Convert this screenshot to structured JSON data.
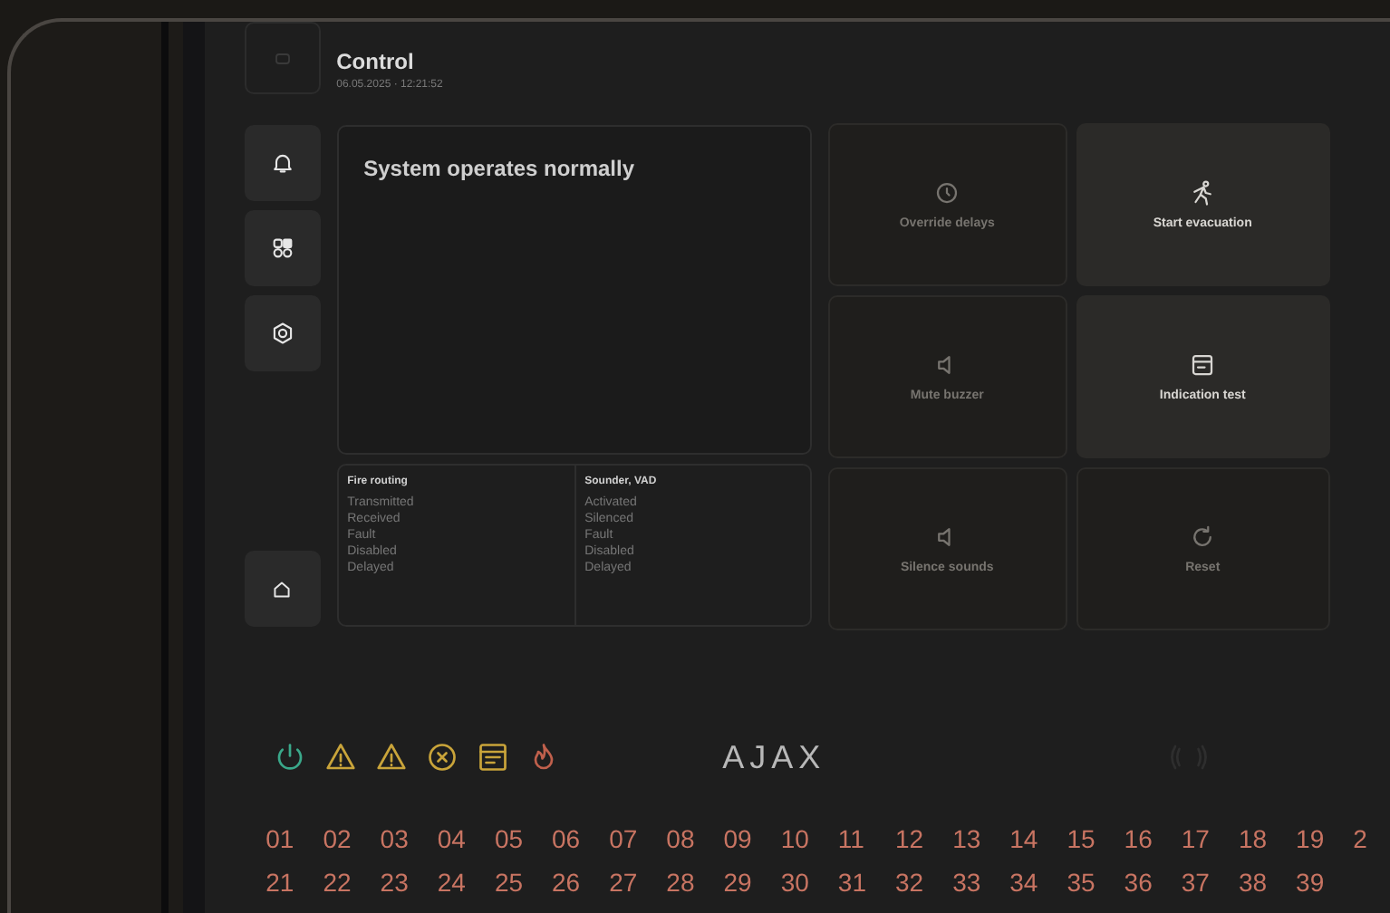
{
  "header": {
    "title": "Control",
    "datetime": "06.05.2025 · 12:21:52"
  },
  "status": {
    "message": "System operates normally"
  },
  "routing": [
    {
      "title": "Fire routing",
      "items": [
        "Transmitted",
        "Received",
        "Fault",
        "Disabled",
        "Delayed"
      ]
    },
    {
      "title": "Sounder, VAD",
      "items": [
        "Activated",
        "Silenced",
        "Fault",
        "Disabled",
        "Delayed"
      ]
    }
  ],
  "tiles": [
    {
      "label": "Override delays",
      "disabled": true
    },
    {
      "label": "Start evacuation",
      "disabled": false
    },
    {
      "label": "Mute buzzer",
      "disabled": true
    },
    {
      "label": "Indication test",
      "disabled": false
    },
    {
      "label": "Silence sounds",
      "disabled": true
    },
    {
      "label": "Reset",
      "disabled": true
    }
  ],
  "indicators": [
    {
      "color": "#3aa88a"
    },
    {
      "color": "#c9a43a"
    },
    {
      "color": "#c9a43a"
    },
    {
      "color": "#c9a43a"
    },
    {
      "color": "#c9a43a"
    },
    {
      "color": "#c0604c"
    }
  ],
  "logo": "AJAX",
  "zones": [
    [
      "01",
      "02",
      "03",
      "04",
      "05",
      "06",
      "07",
      "08",
      "09",
      "10",
      "11",
      "12",
      "13",
      "14",
      "15",
      "16",
      "17",
      "18",
      "19",
      "2"
    ],
    [
      "21",
      "22",
      "23",
      "24",
      "25",
      "26",
      "27",
      "28",
      "29",
      "30",
      "31",
      "32",
      "33",
      "34",
      "35",
      "36",
      "37",
      "38",
      "39"
    ]
  ]
}
